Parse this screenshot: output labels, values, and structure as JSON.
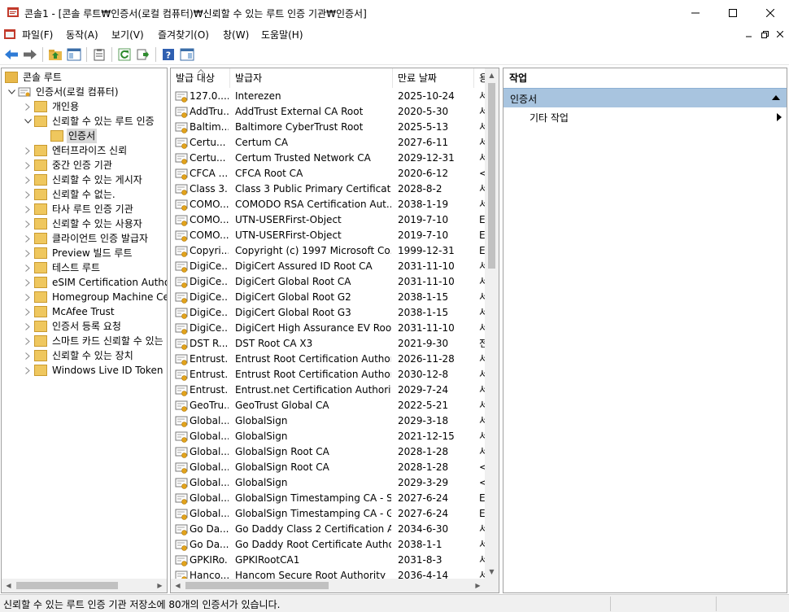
{
  "window": {
    "title": "콘솔1 - [콘솔 루트₩인증서(로컬 컴퓨터)₩신뢰할 수 있는 루트 인증 기관₩인증서]"
  },
  "menu": [
    {
      "label": "파일(F)"
    },
    {
      "label": "동작(A)"
    },
    {
      "label": "보기(V)"
    },
    {
      "label": "즐겨찾기(O)"
    },
    {
      "label": "창(W)"
    },
    {
      "label": "도움말(H)"
    }
  ],
  "toolbar_icons": [
    "back-arrow-icon",
    "forward-arrow-icon",
    "up-folder-icon",
    "show-hide-tree-icon",
    "clipboard-icon",
    "refresh-icon",
    "export-list-icon",
    "help-icon",
    "show-hide-action-pane-icon"
  ],
  "tree": {
    "root": "콘솔 루트",
    "computer": "인증서(로컬 컴퓨터)",
    "items": [
      {
        "label": "개인용",
        "level": 2,
        "expanded": false
      },
      {
        "label": "신뢰할 수 있는 루트 인증",
        "level": 2,
        "expanded": true
      },
      {
        "label": "인증서",
        "level": 3,
        "selected": true
      },
      {
        "label": "엔터프라이즈 신뢰",
        "level": 2,
        "expanded": false
      },
      {
        "label": "중간 인증 기관",
        "level": 2,
        "expanded": false
      },
      {
        "label": "신뢰할 수 있는 게시자",
        "level": 2,
        "expanded": false
      },
      {
        "label": "신뢰할 수 없는.",
        "level": 2,
        "expanded": false
      },
      {
        "label": "타사 루트 인증 기관",
        "level": 2,
        "expanded": false
      },
      {
        "label": "신뢰할 수 있는 사용자",
        "level": 2,
        "expanded": false
      },
      {
        "label": "클라이언트 인증 발급자",
        "level": 2,
        "expanded": false
      },
      {
        "label": "Preview 빌드 루트",
        "level": 2,
        "expanded": false
      },
      {
        "label": "테스트 루트",
        "level": 2,
        "expanded": false
      },
      {
        "label": "eSIM Certification Authoriti",
        "level": 2,
        "expanded": false
      },
      {
        "label": "Homegroup Machine Certi",
        "level": 2,
        "expanded": false
      },
      {
        "label": "McAfee Trust",
        "level": 2,
        "expanded": false
      },
      {
        "label": "인증서 등록 요청",
        "level": 2,
        "expanded": false
      },
      {
        "label": "스마트 카드 신뢰할 수 있는",
        "level": 2,
        "expanded": false
      },
      {
        "label": "신뢰할 수 있는 장치",
        "level": 2,
        "expanded": false
      },
      {
        "label": "Windows Live ID Token Iss",
        "level": 2,
        "expanded": false
      }
    ]
  },
  "list": {
    "columns": [
      "발급 대상",
      "발급자",
      "만료 날짜",
      "용"
    ],
    "rows": [
      [
        "127.0....",
        "Interezen",
        "2025-10-24",
        "서"
      ],
      [
        "AddTru...",
        "AddTrust External CA Root",
        "2020-5-30",
        "서"
      ],
      [
        "Baltim...",
        "Baltimore CyberTrust Root",
        "2025-5-13",
        "서"
      ],
      [
        "Certu...",
        "Certum CA",
        "2027-6-11",
        "서"
      ],
      [
        "Certu...",
        "Certum Trusted Network CA",
        "2029-12-31",
        "서"
      ],
      [
        "CFCA ...",
        "CFCA Root CA",
        "2020-6-12",
        "<"
      ],
      [
        "Class 3...",
        "Class 3 Public Primary Certificati...",
        "2028-8-2",
        "서"
      ],
      [
        "COMO...",
        "COMODO RSA Certification Aut...",
        "2038-1-19",
        "서"
      ],
      [
        "COMO...",
        "UTN-USERFirst-Object",
        "2019-7-10",
        "E"
      ],
      [
        "COMO...",
        "UTN-USERFirst-Object",
        "2019-7-10",
        "E"
      ],
      [
        "Copyri...",
        "Copyright (c) 1997 Microsoft Co...",
        "1999-12-31",
        "E"
      ],
      [
        "DigiCe...",
        "DigiCert Assured ID Root CA",
        "2031-11-10",
        "서"
      ],
      [
        "DigiCe...",
        "DigiCert Global Root CA",
        "2031-11-10",
        "서"
      ],
      [
        "DigiCe...",
        "DigiCert Global Root G2",
        "2038-1-15",
        "서"
      ],
      [
        "DigiCe...",
        "DigiCert Global Root G3",
        "2038-1-15",
        "서"
      ],
      [
        "DigiCe...",
        "DigiCert High Assurance EV Root...",
        "2031-11-10",
        "서"
      ],
      [
        "DST R...",
        "DST Root CA X3",
        "2021-9-30",
        "전"
      ],
      [
        "Entrust...",
        "Entrust Root Certification Authori...",
        "2026-11-28",
        "서"
      ],
      [
        "Entrust...",
        "Entrust Root Certification Authori...",
        "2030-12-8",
        "서"
      ],
      [
        "Entrust...",
        "Entrust.net Certification Authorit...",
        "2029-7-24",
        "서"
      ],
      [
        "GeoTru...",
        "GeoTrust Global CA",
        "2022-5-21",
        "서"
      ],
      [
        "Global...",
        "GlobalSign",
        "2029-3-18",
        "서"
      ],
      [
        "Global...",
        "GlobalSign",
        "2021-12-15",
        "서"
      ],
      [
        "Global...",
        "GlobalSign Root CA",
        "2028-1-28",
        "서"
      ],
      [
        "Global...",
        "GlobalSign Root CA",
        "2028-1-28",
        "<"
      ],
      [
        "Global...",
        "GlobalSign",
        "2029-3-29",
        "<"
      ],
      [
        "Global...",
        "GlobalSign Timestamping CA - S...",
        "2027-6-24",
        "E"
      ],
      [
        "Global...",
        "GlobalSign Timestamping CA - G2",
        "2027-6-24",
        "E"
      ],
      [
        "Go Da...",
        "Go Daddy Class 2 Certification A...",
        "2034-6-30",
        "서"
      ],
      [
        "Go Da...",
        "Go Daddy Root Certificate Autho...",
        "2038-1-1",
        "서"
      ],
      [
        "GPKIRo...",
        "GPKIRootCA1",
        "2031-8-3",
        "서"
      ],
      [
        "Hanco...",
        "Hancom Secure Root Authority",
        "2036-4-14",
        "서"
      ]
    ]
  },
  "actions": {
    "header": "작업",
    "section": "인증서",
    "item": "기타 작업"
  },
  "status": {
    "text": "신뢰할 수 있는 루트 인증 기관 저장소에 80개의 인증서가 있습니다."
  }
}
